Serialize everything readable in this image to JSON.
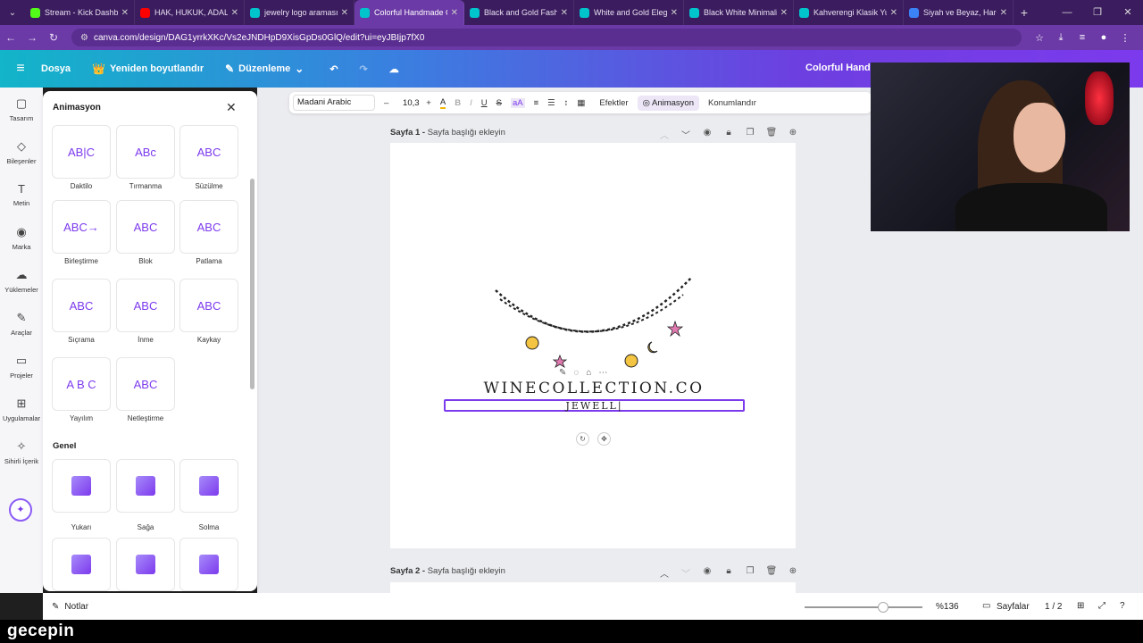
{
  "browser": {
    "tabs": [
      {
        "title": "Stream - Kick Dashbo",
        "color": "#53fc18",
        "active": false
      },
      {
        "title": "HAK, HUKUK, ADALET",
        "color": "#ff0000",
        "active": false
      },
      {
        "title": "jewelry logo araması",
        "color": "#00c4cc",
        "active": false
      },
      {
        "title": "Colorful Handmade C",
        "color": "#00c4cc",
        "active": true
      },
      {
        "title": "Black and Gold Fashi",
        "color": "#00c4cc",
        "active": false
      },
      {
        "title": "White and Gold Eleg",
        "color": "#00c4cc",
        "active": false
      },
      {
        "title": "Black White Minimali",
        "color": "#00c4cc",
        "active": false
      },
      {
        "title": "Kahverengi Klasik Yu",
        "color": "#00c4cc",
        "active": false
      },
      {
        "title": "Siyah ve Beyaz, Hare",
        "color": "#3b82f6",
        "active": false
      }
    ],
    "url": "canva.com/design/DAG1yrrkXKc/Vs2eJNDHpD9XisGpDs0GlQ/edit?ui=eyJBIjp7fX0"
  },
  "header": {
    "file": "Dosya",
    "resize": "Yeniden boyutlandır",
    "edit": "Düzenleme",
    "title": "Colorful Handm"
  },
  "rail": [
    {
      "icon": "▢",
      "label": "Tasarım"
    },
    {
      "icon": "◇",
      "label": "Bileşenler"
    },
    {
      "icon": "T",
      "label": "Metin"
    },
    {
      "icon": "◉",
      "label": "Marka"
    },
    {
      "icon": "☁",
      "label": "Yüklemeler"
    },
    {
      "icon": "✎",
      "label": "Araçlar"
    },
    {
      "icon": "▭",
      "label": "Projeler"
    },
    {
      "icon": "⊞",
      "label": "Uygulamalar"
    },
    {
      "icon": "✧",
      "label": "Sihirli İçerik"
    }
  ],
  "panel": {
    "title": "Animasyon",
    "section_general": "Genel",
    "text_anims": [
      {
        "label": "Daktilo",
        "preview": "AB|C"
      },
      {
        "label": "Tırmanma",
        "preview": "ABc"
      },
      {
        "label": "Süzülme",
        "preview": "ABC"
      },
      {
        "label": "Birleştirme",
        "preview": "ABC→"
      },
      {
        "label": "Blok",
        "preview": "ABC"
      },
      {
        "label": "Patlama",
        "preview": "ABC"
      },
      {
        "label": "Sıçrama",
        "preview": "ABC"
      },
      {
        "label": "İnme",
        "preview": "ABC"
      },
      {
        "label": "Kaykay",
        "preview": "ABC"
      },
      {
        "label": "Yayılım",
        "preview": "A B C"
      },
      {
        "label": "Netleştirme",
        "preview": "ABC"
      }
    ],
    "general_anims": [
      {
        "label": "Yukarı"
      },
      {
        "label": "Sağa"
      },
      {
        "label": "Solma"
      },
      {
        "label": ""
      },
      {
        "label": ""
      },
      {
        "label": ""
      }
    ]
  },
  "toolbar": {
    "font": "Madani Arabic",
    "size": "10,3",
    "effects": "Efektler",
    "animation": "Animasyon",
    "position": "Konumlandır"
  },
  "pages": {
    "page1_label": "Sayfa 1 -",
    "page1_placeholder": "Sayfa başlığı ekleyin",
    "page2_label": "Sayfa 2 -",
    "page2_placeholder": "Sayfa başlığı ekleyin"
  },
  "logo": {
    "main": "WINECOLLECTION.CO",
    "sub": "JEWELL|"
  },
  "bottom": {
    "notes": "Notlar",
    "zoom": "%136",
    "pages": "Sayfalar",
    "page_count": "1 / 2"
  },
  "brand": "gecepin"
}
